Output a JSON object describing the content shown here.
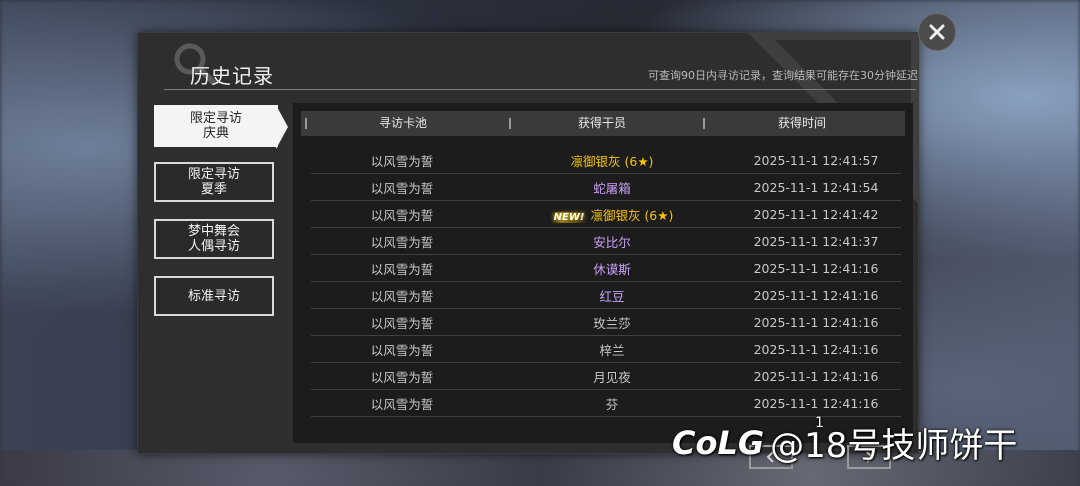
{
  "dialog": {
    "title": "历史记录",
    "subtitle": "可查询90日内寻访记录，查询结果可能存在30分钟延迟"
  },
  "tabs": [
    {
      "label": "限定寻访\n庆典",
      "active": true
    },
    {
      "label": "限定寻访\n夏季",
      "active": false
    },
    {
      "label": "梦中舞会\n人偶寻访",
      "active": false
    },
    {
      "label": "标准寻访",
      "active": false
    }
  ],
  "table": {
    "headers": [
      "寻访卡池",
      "获得干员",
      "获得时间"
    ],
    "rows": [
      {
        "pool": "以风雪为誓",
        "operator": "凛御银灰 (6★)",
        "rarity": "6",
        "is_new": false,
        "time": "2025-11-1 12:41:57"
      },
      {
        "pool": "以风雪为誓",
        "operator": "蛇屠箱",
        "rarity": "5",
        "is_new": false,
        "time": "2025-11-1 12:41:54"
      },
      {
        "pool": "以风雪为誓",
        "operator": "凛御银灰 (6★)",
        "rarity": "6",
        "is_new": true,
        "time": "2025-11-1 12:41:42"
      },
      {
        "pool": "以风雪为誓",
        "operator": "安比尔",
        "rarity": "5",
        "is_new": false,
        "time": "2025-11-1 12:41:37"
      },
      {
        "pool": "以风雪为誓",
        "operator": "休谟斯",
        "rarity": "5",
        "is_new": false,
        "time": "2025-11-1 12:41:16"
      },
      {
        "pool": "以风雪为誓",
        "operator": "红豆",
        "rarity": "5",
        "is_new": false,
        "time": "2025-11-1 12:41:16"
      },
      {
        "pool": "以风雪为誓",
        "operator": "玫兰莎",
        "rarity": "4",
        "is_new": false,
        "time": "2025-11-1 12:41:16"
      },
      {
        "pool": "以风雪为誓",
        "operator": "梓兰",
        "rarity": "4",
        "is_new": false,
        "time": "2025-11-1 12:41:16"
      },
      {
        "pool": "以风雪为誓",
        "operator": "月见夜",
        "rarity": "4",
        "is_new": false,
        "time": "2025-11-1 12:41:16"
      },
      {
        "pool": "以风雪为誓",
        "operator": "芬",
        "rarity": "4",
        "is_new": false,
        "time": "2025-11-1 12:41:16"
      }
    ],
    "new_badge": "NEW!"
  },
  "pagination": {
    "prev_icon": "chevron-left-icon",
    "next_icon": "chevron-right-icon",
    "current_page": "1"
  },
  "watermark": {
    "logo": "CoLG",
    "text": "@18号技师饼干"
  },
  "colors": {
    "six_star": "#f6c400",
    "five_star": "#c9a0f5",
    "four_star": "#c8c8c8"
  }
}
